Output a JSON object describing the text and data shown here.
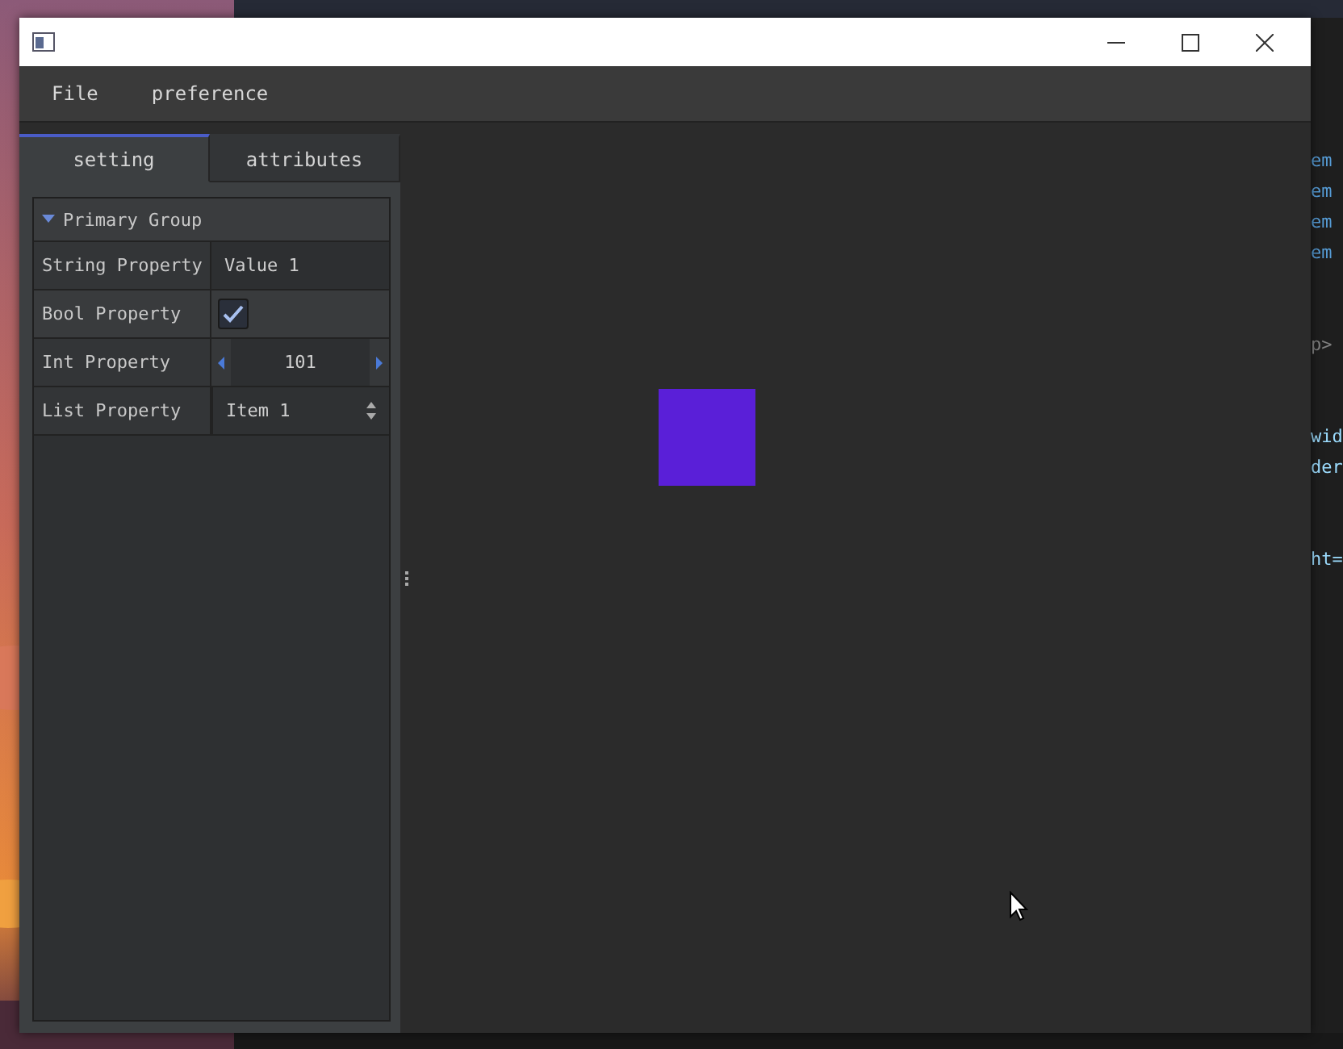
{
  "menu": [
    {
      "label": "File"
    },
    {
      "label": "preference"
    }
  ],
  "tabs": [
    {
      "label": "setting",
      "selected": true
    },
    {
      "label": "attributes",
      "selected": false
    }
  ],
  "group": {
    "label": "Primary Group",
    "expanded": true,
    "properties": [
      {
        "kind": "string",
        "label": "String Property",
        "value": "Value 1"
      },
      {
        "kind": "bool",
        "label": "Bool Property",
        "checked": true
      },
      {
        "kind": "int",
        "label": "Int Property",
        "value": "101"
      },
      {
        "kind": "list",
        "label": "List Property",
        "value": "Item 1"
      }
    ]
  },
  "background_editor": {
    "lines": [
      {
        "kind": "tag",
        "text": "em"
      },
      {
        "kind": "tag",
        "text": "em"
      },
      {
        "kind": "tag",
        "text": "em"
      },
      {
        "kind": "tag",
        "text": "em"
      },
      {
        "kind": "blank"
      },
      {
        "kind": "blank"
      },
      {
        "kind": "punct",
        "text": "p>"
      },
      {
        "kind": "blank"
      },
      {
        "kind": "blank"
      },
      {
        "kind": "attr",
        "text": "wid"
      },
      {
        "kind": "attr",
        "text": "der"
      },
      {
        "kind": "blank"
      },
      {
        "kind": "blank"
      },
      {
        "kind": "attr",
        "text": "ht="
      }
    ]
  }
}
